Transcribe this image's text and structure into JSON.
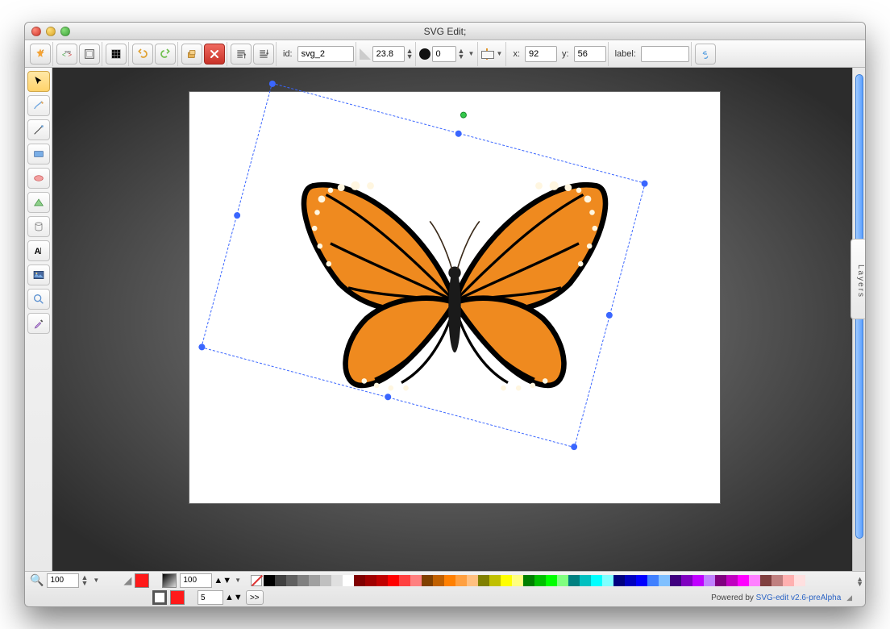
{
  "window": {
    "title": "SVG Edit;"
  },
  "toolbar": {
    "id_label": "id:",
    "id_value": "svg_2",
    "angle_value": "23.8",
    "blur_value": "0",
    "x_label": "x:",
    "x_value": "92",
    "y_label": "y:",
    "y_value": "56",
    "label_label": "label:",
    "label_value": ""
  },
  "bottom": {
    "zoom_value": "100",
    "opacity_value": "100",
    "stroke_width_value": "5",
    "expand_label": ">>"
  },
  "footer": {
    "powered_text": "Powered by ",
    "link_text": "SVG-edit v2.6-preAlpha"
  },
  "layers": {
    "tab_label": "Layers"
  },
  "palette": [
    "#000000",
    "#404040",
    "#606060",
    "#808080",
    "#a0a0a0",
    "#c0c0c0",
    "#e0e0e0",
    "#ffffff",
    "#800000",
    "#a00000",
    "#c00000",
    "#ff0000",
    "#ff4040",
    "#ff8080",
    "#804000",
    "#c06000",
    "#ff8000",
    "#ffa040",
    "#ffc080",
    "#808000",
    "#c0c000",
    "#ffff00",
    "#ffff80",
    "#008000",
    "#00c000",
    "#00ff00",
    "#80ff80",
    "#008080",
    "#00c0c0",
    "#00ffff",
    "#80ffff",
    "#000080",
    "#0000c0",
    "#0000ff",
    "#4080ff",
    "#80c0ff",
    "#400080",
    "#8000c0",
    "#c000ff",
    "#c080ff",
    "#800080",
    "#c000c0",
    "#ff00ff",
    "#ff80ff",
    "#804040",
    "#c08080",
    "#ffb0b0",
    "#ffe0e0"
  ]
}
